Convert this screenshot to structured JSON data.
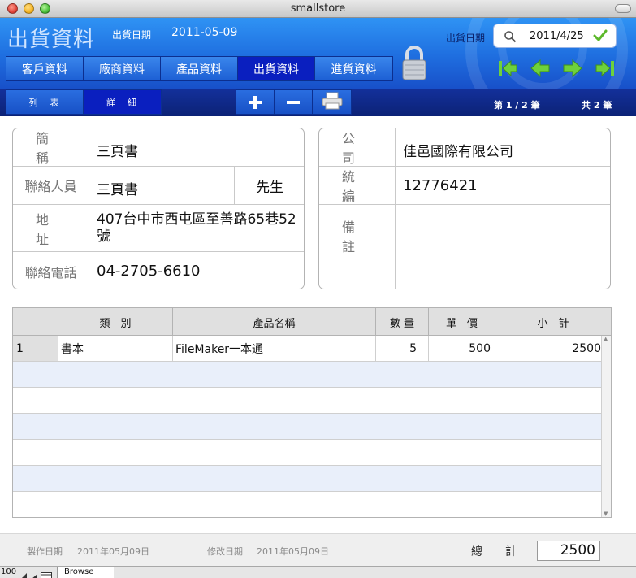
{
  "window": {
    "title": "smallstore"
  },
  "header": {
    "page_title": "出貨資料",
    "ship_date_label": "出貨日期",
    "ship_date_value": "2011-05-09",
    "find_label": "出貨日期",
    "find_value": "2011/4/25",
    "nav_tabs": [
      "客戶資料",
      "廠商資料",
      "產品資料",
      "出貨資料",
      "進貨資料"
    ],
    "active_tab": "出貨資料",
    "sub_tabs": [
      "列　表",
      "詳　細"
    ],
    "record_position": "第 1 / 2 筆",
    "record_total": "共 2 筆",
    "colors": {
      "header_blue": "#1f6fe0",
      "active_tab": "#0a1fbf",
      "arrow_green": "#6ed13c"
    }
  },
  "customer": {
    "short_name_label": "簡稱",
    "short_name": "三頁書",
    "contact_label": "聯絡人員",
    "contact": "三頁書",
    "contact_title": "先生",
    "address_label": "地址",
    "address": "407台中市西屯區至善路65巷52號",
    "phone_label": "聯絡電話",
    "phone": "04-2705-6610"
  },
  "company": {
    "company_label": "公司",
    "company": "佳邑國際有限公司",
    "tax_id_label": "統編",
    "tax_id": "12776421",
    "note_label": "備註",
    "note": ""
  },
  "items": {
    "headers": [
      "類　別",
      "產品名稱",
      "數 量",
      "單　價",
      "小　計"
    ],
    "rows": [
      {
        "no": "1",
        "category": "書本",
        "product": "FileMaker一本通",
        "qty": "5",
        "price": "500",
        "subtotal": "2500"
      }
    ]
  },
  "footer": {
    "created_label": "製作日期",
    "created": "2011年05月09日",
    "modified_label": "修改日期",
    "modified": "2011年05月09日",
    "total_label": "總　　計",
    "total": "2500"
  },
  "status": {
    "zoom": "100",
    "mode": "Browse"
  }
}
